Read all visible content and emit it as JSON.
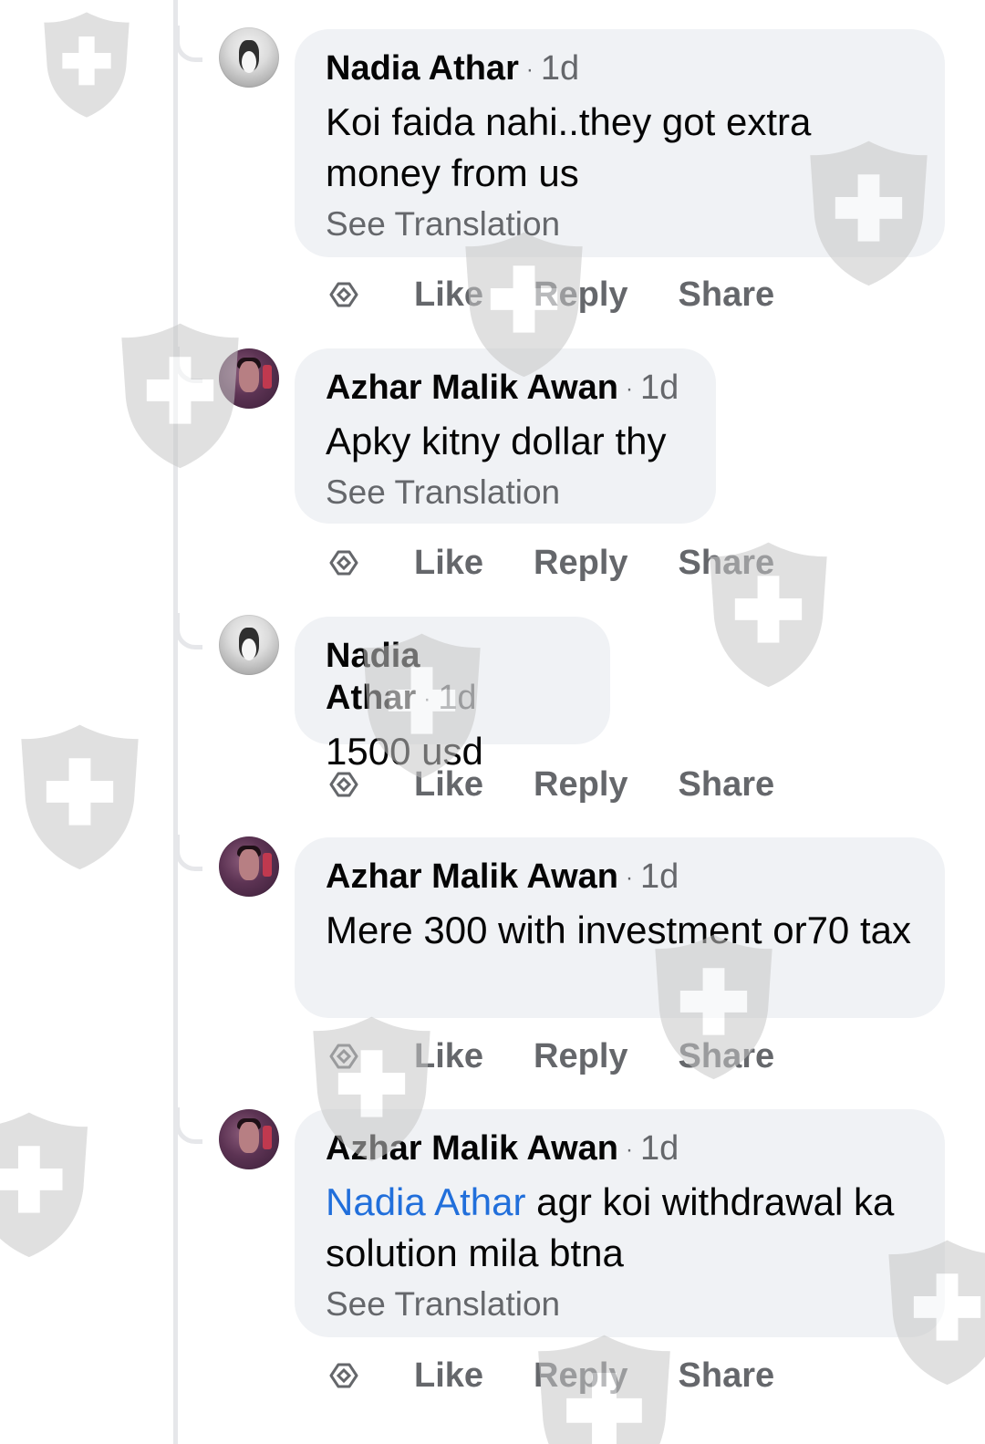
{
  "comments": [
    {
      "author": "Nadia Athar",
      "time": "1d",
      "text": "Koi faida nahi..they got extra money from us",
      "see_translation": "See Translation",
      "avatar": "penguin"
    },
    {
      "author": "Azhar Malik Awan",
      "time": "1d",
      "text": "Apky kitny dollar thy",
      "see_translation": "See Translation",
      "avatar": "man"
    },
    {
      "author": "Nadia Athar",
      "time": "1d",
      "text": "1500 usd",
      "avatar": "penguin"
    },
    {
      "author": "Azhar Malik Awan",
      "time": "1d",
      "text": "Mere 300 with investment or70 tax",
      "avatar": "man"
    },
    {
      "author": "Azhar Malik Awan",
      "time": "1d",
      "mention": "Nadia Athar",
      "text": " agr koi withdrawal ka solution mila btna",
      "see_translation": "See Translation",
      "avatar": "man"
    }
  ],
  "actions": {
    "like": "Like",
    "reply": "Reply",
    "share": "Share"
  },
  "time_separator": "·",
  "colors": {
    "bubble": "#f0f2f5",
    "mention": "#216fdb",
    "secondary_text": "#65676b",
    "watermark": "#bdbdbd"
  }
}
